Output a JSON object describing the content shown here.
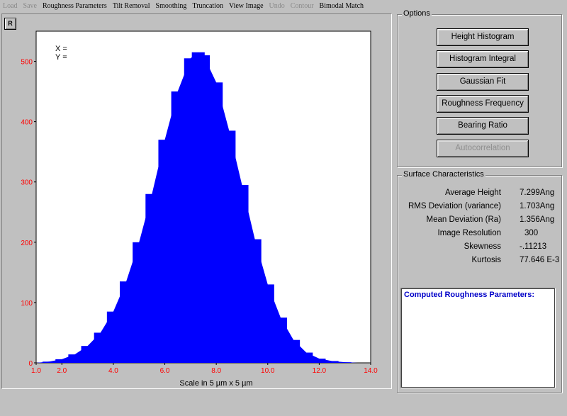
{
  "menu": [
    {
      "label": "Load",
      "enabled": false
    },
    {
      "label": "Save",
      "enabled": false
    },
    {
      "label": "Roughness Parameters",
      "enabled": true
    },
    {
      "label": "Tilt Removal",
      "enabled": true
    },
    {
      "label": "Smoothing",
      "enabled": true
    },
    {
      "label": "Truncation",
      "enabled": true
    },
    {
      "label": "View Image",
      "enabled": true
    },
    {
      "label": "Undo",
      "enabled": false
    },
    {
      "label": "Contour",
      "enabled": false
    },
    {
      "label": "Bimodal Match",
      "enabled": true
    }
  ],
  "graph": {
    "r_button_label": "R",
    "cursor_x_label": "X =",
    "cursor_y_label": "Y =",
    "xlabel": "Scale in 5 µm x 5 µm"
  },
  "chart_data": {
    "type": "bar",
    "title": "",
    "xlabel": "Scale in 5 µm x 5 µm",
    "ylabel": "",
    "xlim": [
      1.0,
      14.0
    ],
    "ylim": [
      0,
      550
    ],
    "x_ticks": [
      "1.0",
      "2.0",
      "4.0",
      "6.0",
      "8.0",
      "10.0",
      "12.0",
      "14.0"
    ],
    "x_tick_values": [
      1.0,
      2.0,
      4.0,
      6.0,
      8.0,
      10.0,
      12.0,
      14.0
    ],
    "y_ticks": [
      "0",
      "100",
      "200",
      "300",
      "400",
      "500"
    ],
    "y_tick_values": [
      0,
      100,
      200,
      300,
      400,
      500
    ],
    "series": [
      {
        "color": "#0000ff",
        "x": [
          1.0,
          1.5,
          2.0,
          2.5,
          3.0,
          3.5,
          4.0,
          4.5,
          5.0,
          5.5,
          6.0,
          6.5,
          7.0,
          7.3,
          7.5,
          8.0,
          8.5,
          9.0,
          9.5,
          10.0,
          10.5,
          11.0,
          11.5,
          12.0,
          12.5,
          13.0,
          13.5
        ],
        "values": [
          0,
          2,
          6,
          14,
          28,
          50,
          85,
          135,
          200,
          280,
          370,
          450,
          505,
          515,
          510,
          465,
          385,
          295,
          205,
          130,
          75,
          38,
          17,
          7,
          3,
          1,
          0
        ]
      }
    ],
    "tick_color": "#ff0000"
  },
  "options": {
    "title": "Options",
    "buttons": [
      {
        "label": "Height Histogram",
        "enabled": true
      },
      {
        "label": "Histogram Integral",
        "enabled": true
      },
      {
        "label": "Gaussian Fit",
        "enabled": true
      },
      {
        "label": "Roughness Frequency",
        "enabled": true
      },
      {
        "label": "Bearing Ratio",
        "enabled": true
      },
      {
        "label": "Autocorrelation",
        "enabled": false
      }
    ]
  },
  "surface": {
    "title": "Surface Characteristics",
    "rows": [
      {
        "label": "Average Height",
        "value": "7.299",
        "unit": "Ang"
      },
      {
        "label": "RMS Deviation (variance)",
        "value": "1.703",
        "unit": "Ang"
      },
      {
        "label": "Mean Deviation (Ra)",
        "value": "1.356",
        "unit": "Ang"
      },
      {
        "label": "Image Resolution",
        "value": "300",
        "unit": ""
      },
      {
        "label": "Skewness",
        "value": "-.11213",
        "unit": ""
      },
      {
        "label": "Kurtosis",
        "value": "77.646 E-3",
        "unit": ""
      }
    ],
    "computed_title": "Computed Roughness Parameters:"
  }
}
